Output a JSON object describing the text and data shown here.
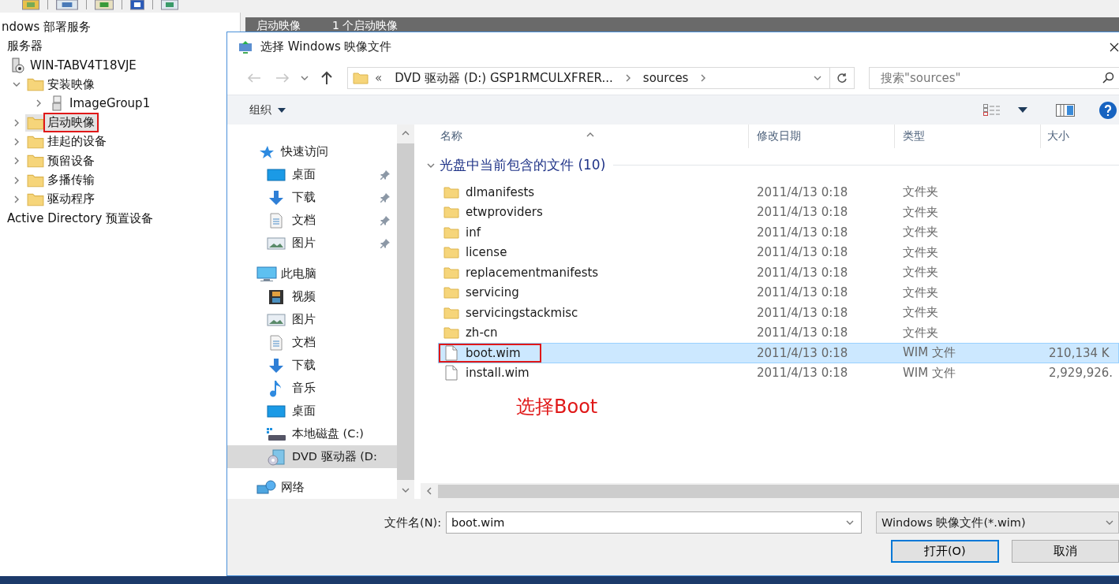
{
  "console": {
    "tree": {
      "label": "ndows 部署服务",
      "selected": false,
      "children": [
        {
          "label": "服务器",
          "selected": false,
          "children": [
            {
              "label": "WIN-TABV4T18VJE",
              "selected": false,
              "children": [
                {
                  "label": "安装映像",
                  "expanded": true,
                  "selected": false,
                  "marked": false,
                  "children": [
                    {
                      "label": "ImageGroup1",
                      "expanded": false,
                      "selected": false,
                      "marked": false
                    }
                  ]
                },
                {
                  "label": "启动映像",
                  "expanded": false,
                  "selected": true,
                  "marked": true
                },
                {
                  "label": "挂起的设备",
                  "expanded": false,
                  "selected": false,
                  "marked": false
                },
                {
                  "label": "预留设备",
                  "expanded": false,
                  "selected": false,
                  "marked": false
                },
                {
                  "label": "多播传输",
                  "expanded": false,
                  "selected": false,
                  "marked": false
                },
                {
                  "label": "驱动程序",
                  "expanded": false,
                  "selected": false,
                  "marked": false
                }
              ]
            }
          ]
        },
        {
          "label": "Active Directory 预置设备",
          "selected": false
        }
      ]
    },
    "detail_header": {
      "title": "启动映像",
      "count": "1 个启动映像"
    }
  },
  "dialog": {
    "title": "选择 Windows 映像文件",
    "address": {
      "overflow_mark": "«",
      "path": [
        "DVD 驱动器 (D:) GSP1RMCULXFRER...",
        "sources"
      ]
    },
    "search": {
      "placeholder": "搜索\"sources\""
    },
    "organize": "组织",
    "nav": [
      {
        "label": "快速访问",
        "kind": "group",
        "selected": false
      },
      {
        "label": "桌面",
        "kind": "item",
        "pinned": true,
        "selected": false
      },
      {
        "label": "下载",
        "kind": "item",
        "pinned": true,
        "selected": false
      },
      {
        "label": "文档",
        "kind": "item",
        "pinned": true,
        "selected": false
      },
      {
        "label": "图片",
        "kind": "item",
        "pinned": true,
        "selected": false
      },
      {
        "label": "此电脑",
        "kind": "group",
        "selected": false
      },
      {
        "label": "视频",
        "kind": "item",
        "pinned": false,
        "selected": false
      },
      {
        "label": "图片",
        "kind": "item",
        "pinned": false,
        "selected": false
      },
      {
        "label": "文档",
        "kind": "item",
        "pinned": false,
        "selected": false
      },
      {
        "label": "下载",
        "kind": "item",
        "pinned": false,
        "selected": false
      },
      {
        "label": "音乐",
        "kind": "item",
        "pinned": false,
        "selected": false
      },
      {
        "label": "桌面",
        "kind": "item",
        "pinned": false,
        "selected": false
      },
      {
        "label": "本地磁盘 (C:)",
        "kind": "item",
        "pinned": false,
        "selected": false
      },
      {
        "label": "DVD 驱动器 (D:",
        "kind": "item",
        "pinned": false,
        "selected": true
      },
      {
        "label": "网络",
        "kind": "group",
        "selected": false
      }
    ],
    "columns": [
      "名称",
      "修改日期",
      "类型",
      "大小"
    ],
    "group": {
      "label": "光盘中当前包含的文件 (10)",
      "expanded": true
    },
    "files": [
      {
        "kind": "folder",
        "name": "dlmanifests",
        "modified": "2011/4/13 0:18",
        "type": "文件夹",
        "selected": false,
        "marked": false
      },
      {
        "kind": "folder",
        "name": "etwproviders",
        "modified": "2011/4/13 0:18",
        "type": "文件夹",
        "selected": false,
        "marked": false
      },
      {
        "kind": "folder",
        "name": "inf",
        "modified": "2011/4/13 0:18",
        "type": "文件夹",
        "selected": false,
        "marked": false
      },
      {
        "kind": "folder",
        "name": "license",
        "modified": "2011/4/13 0:18",
        "type": "文件夹",
        "selected": false,
        "marked": false
      },
      {
        "kind": "folder",
        "name": "replacementmanifests",
        "modified": "2011/4/13 0:18",
        "type": "文件夹",
        "selected": false,
        "marked": false
      },
      {
        "kind": "folder",
        "name": "servicing",
        "modified": "2011/4/13 0:18",
        "type": "文件夹",
        "selected": false,
        "marked": false
      },
      {
        "kind": "folder",
        "name": "servicingstackmisc",
        "modified": "2011/4/13 0:18",
        "type": "文件夹",
        "selected": false,
        "marked": false
      },
      {
        "kind": "folder",
        "name": "zh-cn",
        "modified": "2011/4/13 0:18",
        "type": "文件夹",
        "selected": false,
        "marked": false
      },
      {
        "kind": "file",
        "name": "boot.wim",
        "modified": "2011/4/13 0:18",
        "type": "WIM 文件",
        "size": "210,134 K",
        "selected": true,
        "marked": true
      },
      {
        "kind": "file",
        "name": "install.wim",
        "modified": "2011/4/13 0:18",
        "type": "WIM 文件",
        "size": "2,929,926.",
        "selected": false,
        "marked": false
      }
    ],
    "file_name": {
      "label": "文件名(N):",
      "value": "boot.wim"
    },
    "filter": "Windows 映像文件(*.wim)",
    "buttons": [
      {
        "label": "打开(O)",
        "default": true
      },
      {
        "label": "取消",
        "default": false
      }
    ]
  },
  "annotation": {
    "text": "选择Boot"
  }
}
